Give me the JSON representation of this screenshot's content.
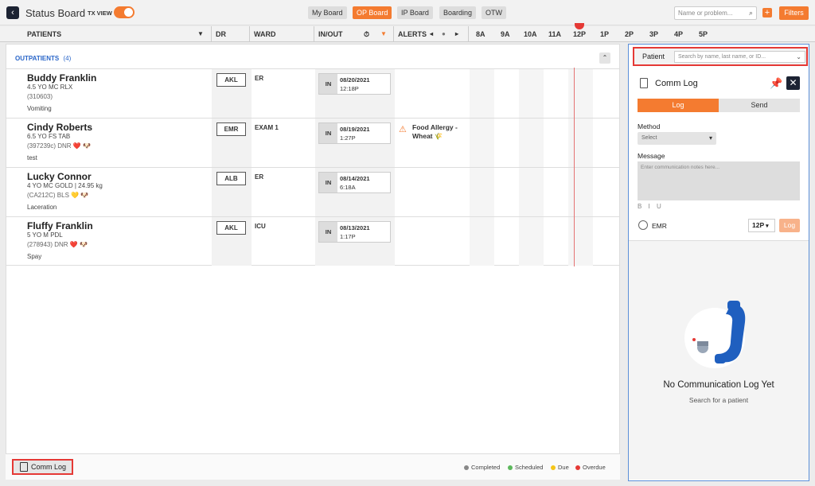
{
  "header": {
    "back_icon": "chevron-left-icon",
    "title": "Status Board",
    "tx_view_label": "TX VIEW",
    "tx_view_on": true,
    "tabs": [
      {
        "label": "My Board",
        "active": false
      },
      {
        "label": "OP Board",
        "active": true
      },
      {
        "label": "IP Board",
        "active": false
      },
      {
        "label": "Boarding",
        "active": false
      },
      {
        "label": "OTW",
        "active": false
      }
    ],
    "search_placeholder": "Name or problem...",
    "add_icon": "plus-icon",
    "filters_label": "Filters",
    "accent_color": "#f47b30"
  },
  "columns": {
    "patients": "PATIENTS",
    "dr": "DR",
    "ward": "WARD",
    "inout": "IN/OUT",
    "alerts": "ALERTS",
    "hours": [
      "8A",
      "9A",
      "10A",
      "11A",
      "12P",
      "1P",
      "2P",
      "3P",
      "4P",
      "5P"
    ]
  },
  "section": {
    "title": "OUTPATIENTS",
    "count": "(4)"
  },
  "patients": [
    {
      "name": "Buddy Franklin",
      "line1": "4.5 YO MC RLX",
      "line2": "(310603)",
      "line3": "Vomiting",
      "dr": "AKL",
      "ward": "ER",
      "in_label": "IN",
      "date": "08/20/2021",
      "time": "12:18P",
      "alert": ""
    },
    {
      "name": "Cindy Roberts",
      "line1": "6.5 YO FS TAB",
      "line2": "(397239c) DNR ❤️ 🐶",
      "line3": "test",
      "dr": "EMR",
      "ward": "EXAM 1",
      "in_label": "IN",
      "date": "08/19/2021",
      "time": "1:27P",
      "alert": "Food Allergy - Wheat 🌾"
    },
    {
      "name": "Lucky Connor",
      "line1": "4 YO MC GOLD | 24.95 kg",
      "line2": "(CA212C) BLS 💛 🐶",
      "line3": "Laceration",
      "dr": "ALB",
      "ward": "ER",
      "in_label": "IN",
      "date": "08/14/2021",
      "time": "6:18A",
      "alert": ""
    },
    {
      "name": "Fluffy Franklin",
      "line1": "5 YO M PDL",
      "line2": "(278943) DNR ❤️ 🐶",
      "line3": "Spay",
      "dr": "AKL",
      "ward": "ICU",
      "in_label": "IN",
      "date": "08/13/2021",
      "time": "1:17P",
      "alert": ""
    }
  ],
  "footer": {
    "comm_log_label": "Comm Log",
    "legend": [
      {
        "label": "Completed",
        "color": "#888888"
      },
      {
        "label": "Scheduled",
        "color": "#5cb85c"
      },
      {
        "label": "Due",
        "color": "#f5c518"
      },
      {
        "label": "Overdue",
        "color": "#e53935"
      }
    ]
  },
  "panel": {
    "patient_label": "Patient",
    "patient_placeholder": "Search by name, last name, or ID...",
    "title": "Comm Log",
    "tab_log": "Log",
    "tab_send": "Send",
    "method_label": "Method",
    "method_value": "Select",
    "message_label": "Message",
    "message_placeholder": "Enter communication notes here...",
    "format_controls": "B I U",
    "user": "EMR",
    "time_value": "12P",
    "log_button": "Log",
    "empty_title": "No Communication Log Yet",
    "empty_subtitle": "Search for a patient"
  }
}
